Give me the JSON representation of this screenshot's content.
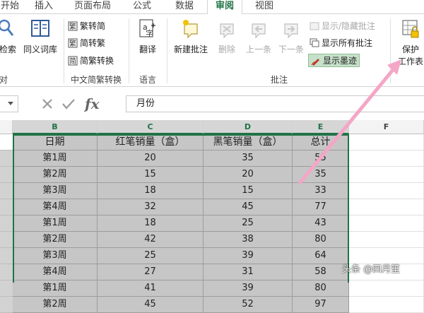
{
  "tabs": [
    "开始",
    "插入",
    "页面布局",
    "公式",
    "数据",
    "审阅",
    "视图"
  ],
  "tabs_partial_first": "开始",
  "ribbon": {
    "proofing": {
      "search_partial": "检索",
      "thesaurus": "同义词库",
      "group_partial": "对"
    },
    "chinese_conversion": {
      "to_simplified": "繁转简",
      "to_traditional": "简转繁",
      "convert": "简繁转换",
      "group": "中文简繁转换"
    },
    "language": {
      "translate": "翻译",
      "group": "语言"
    },
    "comments": {
      "new_comment": "新建批注",
      "delete": "删除",
      "previous": "上一条",
      "next": "下一条",
      "show_hide": "显示/隐藏批注",
      "show_all": "显示所有批注",
      "show_ink": "显示墨迹",
      "group": "批注"
    },
    "protect": {
      "line1": "保护",
      "line2": "工作表"
    }
  },
  "formula_bar": {
    "fx": "fx",
    "value": "月份"
  },
  "grid": {
    "columns": [
      "B",
      "C",
      "D",
      "E",
      "F"
    ],
    "headers": [
      "日期",
      "红笔销量（盒）",
      "黑笔销量（盒）",
      "总计"
    ],
    "rows": [
      [
        "第1周",
        "20",
        "35",
        "55"
      ],
      [
        "第2周",
        "15",
        "20",
        "35"
      ],
      [
        "第3周",
        "18",
        "15",
        "33"
      ],
      [
        "第4周",
        "32",
        "45",
        "77"
      ],
      [
        "第1周",
        "18",
        "25",
        "43"
      ],
      [
        "第2周",
        "42",
        "38",
        "80"
      ],
      [
        "第3周",
        "25",
        "39",
        "64"
      ],
      [
        "第4周",
        "27",
        "31",
        "58"
      ],
      [
        "第1周",
        "41",
        "39",
        "80"
      ],
      [
        "第2周",
        "45",
        "52",
        "97"
      ]
    ]
  },
  "colors": {
    "accent": "#217346",
    "arrow": "#f4a6c6",
    "selection_fill": "#c6c6c6"
  },
  "watermark": "头条 @四月笙"
}
